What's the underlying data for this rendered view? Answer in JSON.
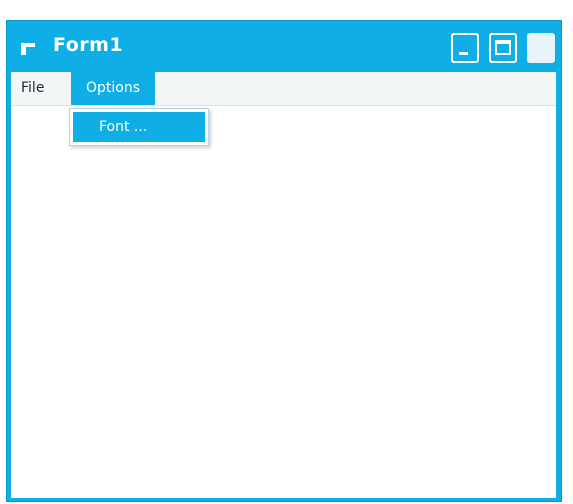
{
  "window": {
    "title": "Form1",
    "icons": {
      "app": "form-app-icon",
      "minimize": "minimize-icon",
      "maximize": "maximize-icon",
      "close": "close-icon"
    }
  },
  "menubar": {
    "items": [
      {
        "label": "File"
      },
      {
        "label": "Options",
        "open": true
      }
    ]
  },
  "options_menu": {
    "items": [
      {
        "label": "Font ...",
        "highlighted": true
      }
    ]
  },
  "colors": {
    "titlebar": "#10aee6",
    "menubar": "#f2f6f7",
    "highlight": "#10aee6",
    "client": "#ffffff"
  }
}
